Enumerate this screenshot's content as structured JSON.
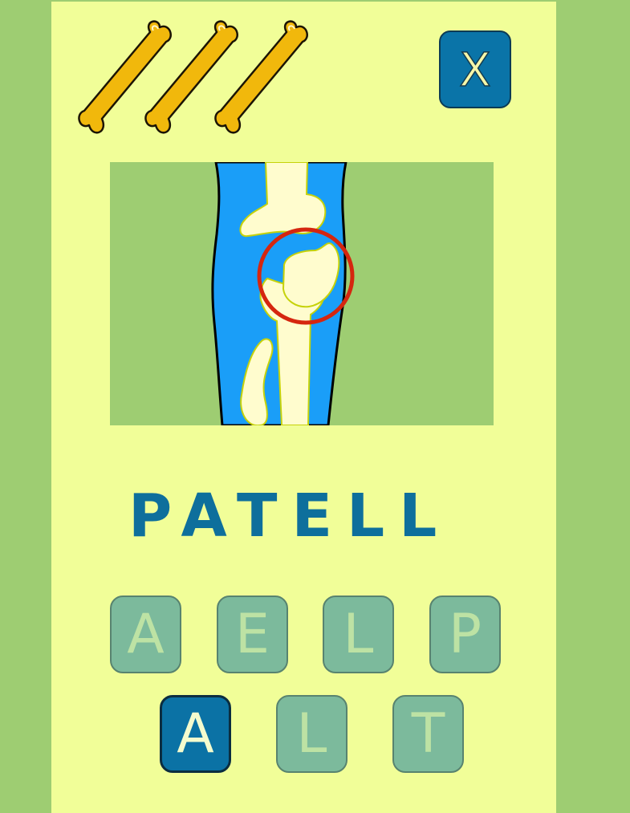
{
  "game": {
    "lives_icon": "bone-icon",
    "lives_remaining": 3,
    "close_label": "X",
    "xray": {
      "highlight_icon": "red-circle",
      "colors": {
        "background": "#9ecd72",
        "leg": "#1a9ef8",
        "bone": "#fffcce",
        "highlight": "#d5260f"
      }
    },
    "word_progress": "PATELL",
    "letter_tiles": [
      {
        "letter": "A",
        "state": "used"
      },
      {
        "letter": "E",
        "state": "used"
      },
      {
        "letter": "L",
        "state": "used"
      },
      {
        "letter": "P",
        "state": "used"
      },
      {
        "letter": "A",
        "state": "available"
      },
      {
        "letter": "L",
        "state": "used"
      },
      {
        "letter": "T",
        "state": "used"
      }
    ],
    "colors": {
      "page_background": "#9ecd72",
      "panel": "#f1fe98",
      "accent": "#0a74a8",
      "word": "#0e6f9c",
      "bone_life": "#f1b80c"
    }
  }
}
